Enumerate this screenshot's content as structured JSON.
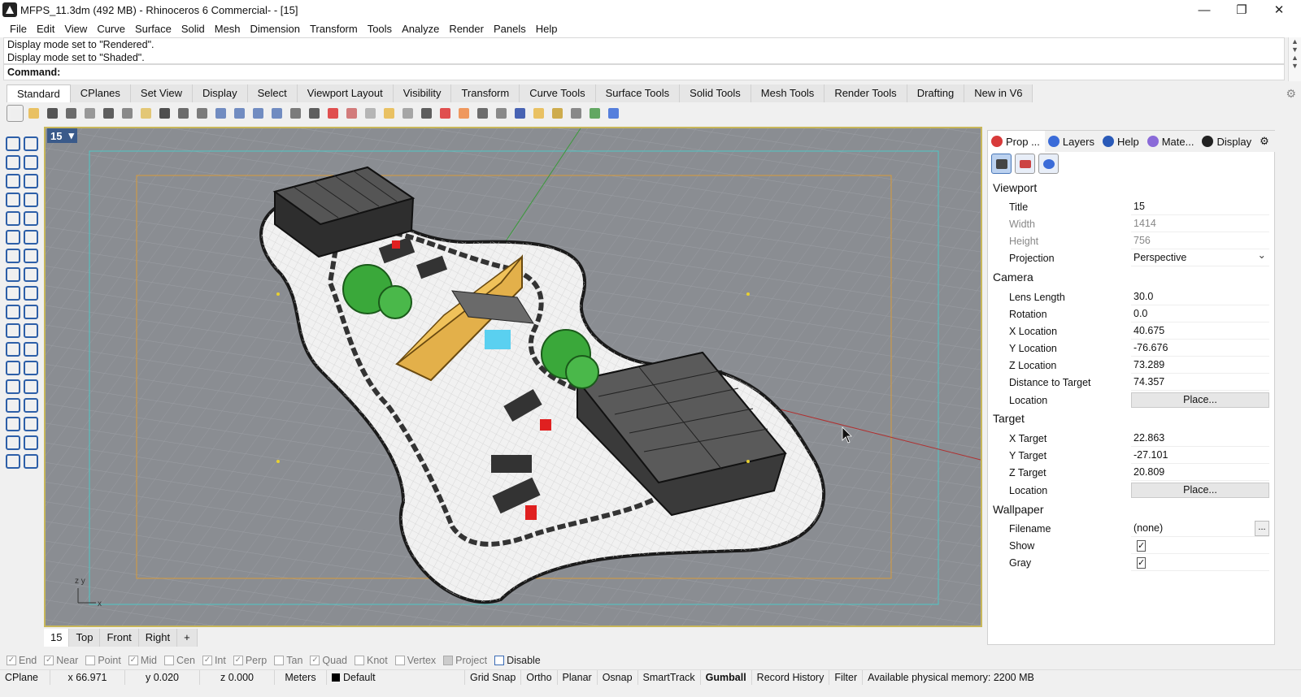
{
  "window": {
    "title": "MFPS_11.3dm (492 MB) - Rhinoceros 6 Commercial- - [15]",
    "minimize": "—",
    "maximize": "❐",
    "close": "✕"
  },
  "menu": [
    "File",
    "Edit",
    "View",
    "Curve",
    "Surface",
    "Solid",
    "Mesh",
    "Dimension",
    "Transform",
    "Tools",
    "Analyze",
    "Render",
    "Panels",
    "Help"
  ],
  "command": {
    "history": [
      "Display mode set to \"Rendered\".",
      "Display mode set to \"Shaded\"."
    ],
    "prompt": "Command:"
  },
  "toolbar_tabs": [
    "Standard",
    "CPlanes",
    "Set View",
    "Display",
    "Select",
    "Viewport Layout",
    "Visibility",
    "Transform",
    "Curve Tools",
    "Surface Tools",
    "Solid Tools",
    "Mesh Tools",
    "Render Tools",
    "Drafting",
    "New in V6"
  ],
  "viewport": {
    "label": "15",
    "tabs": [
      "15",
      "Top",
      "Front",
      "Right"
    ],
    "add_tab": "+"
  },
  "panel": {
    "tabs": [
      "Prop ...",
      "Layers",
      "Help",
      "Mate...",
      "Display"
    ],
    "tab_colors": [
      "#d83a3a",
      "#3a6bd8",
      "#2a5ab8",
      "#8a6ad8",
      "#222222"
    ],
    "viewport": {
      "header": "Viewport",
      "title_label": "Title",
      "title_value": "15",
      "width_label": "Width",
      "width_value": "1414",
      "height_label": "Height",
      "height_value": "756",
      "projection_label": "Projection",
      "projection_value": "Perspective"
    },
    "camera": {
      "header": "Camera",
      "lens_label": "Lens Length",
      "lens_value": "30.0",
      "rotation_label": "Rotation",
      "rotation_value": "0.0",
      "xloc_label": "X Location",
      "xloc_value": "40.675",
      "yloc_label": "Y Location",
      "yloc_value": "-76.676",
      "zloc_label": "Z Location",
      "zloc_value": "73.289",
      "dist_label": "Distance to Target",
      "dist_value": "74.357",
      "loc_label": "Location",
      "loc_button": "Place..."
    },
    "target": {
      "header": "Target",
      "x_label": "X Target",
      "x_value": "22.863",
      "y_label": "Y Target",
      "y_value": "-27.101",
      "z_label": "Z Target",
      "z_value": "20.809",
      "loc_label": "Location",
      "loc_button": "Place..."
    },
    "wallpaper": {
      "header": "Wallpaper",
      "filename_label": "Filename",
      "filename_value": "(none)",
      "browse": "...",
      "show_label": "Show",
      "show_checked": true,
      "gray_label": "Gray",
      "gray_checked": true
    }
  },
  "osnap": [
    {
      "label": "End",
      "checked": true
    },
    {
      "label": "Near",
      "checked": true
    },
    {
      "label": "Point",
      "checked": false
    },
    {
      "label": "Mid",
      "checked": true
    },
    {
      "label": "Cen",
      "checked": false
    },
    {
      "label": "Int",
      "checked": true
    },
    {
      "label": "Perp",
      "checked": true
    },
    {
      "label": "Tan",
      "checked": false
    },
    {
      "label": "Quad",
      "checked": true
    },
    {
      "label": "Knot",
      "checked": false
    },
    {
      "label": "Vertex",
      "checked": false
    },
    {
      "label": "Project",
      "checked": false
    },
    {
      "label": "Disable",
      "checked": false
    }
  ],
  "status": {
    "cplane": "CPlane",
    "x": "x 66.971",
    "y": "y 0.020",
    "z": "z 0.000",
    "units": "Meters",
    "layer": "Default",
    "grid_snap": "Grid Snap",
    "ortho": "Ortho",
    "planar": "Planar",
    "osnap": "Osnap",
    "smarttrack": "SmartTrack",
    "gumball": "Gumball",
    "record_history": "Record History",
    "filter": "Filter",
    "memory": "Available physical memory: 2200 MB"
  },
  "colors": {
    "viewport_bg": "#8a8d92",
    "active_border": "#c8b75a",
    "accent": "#3a6bb5"
  }
}
